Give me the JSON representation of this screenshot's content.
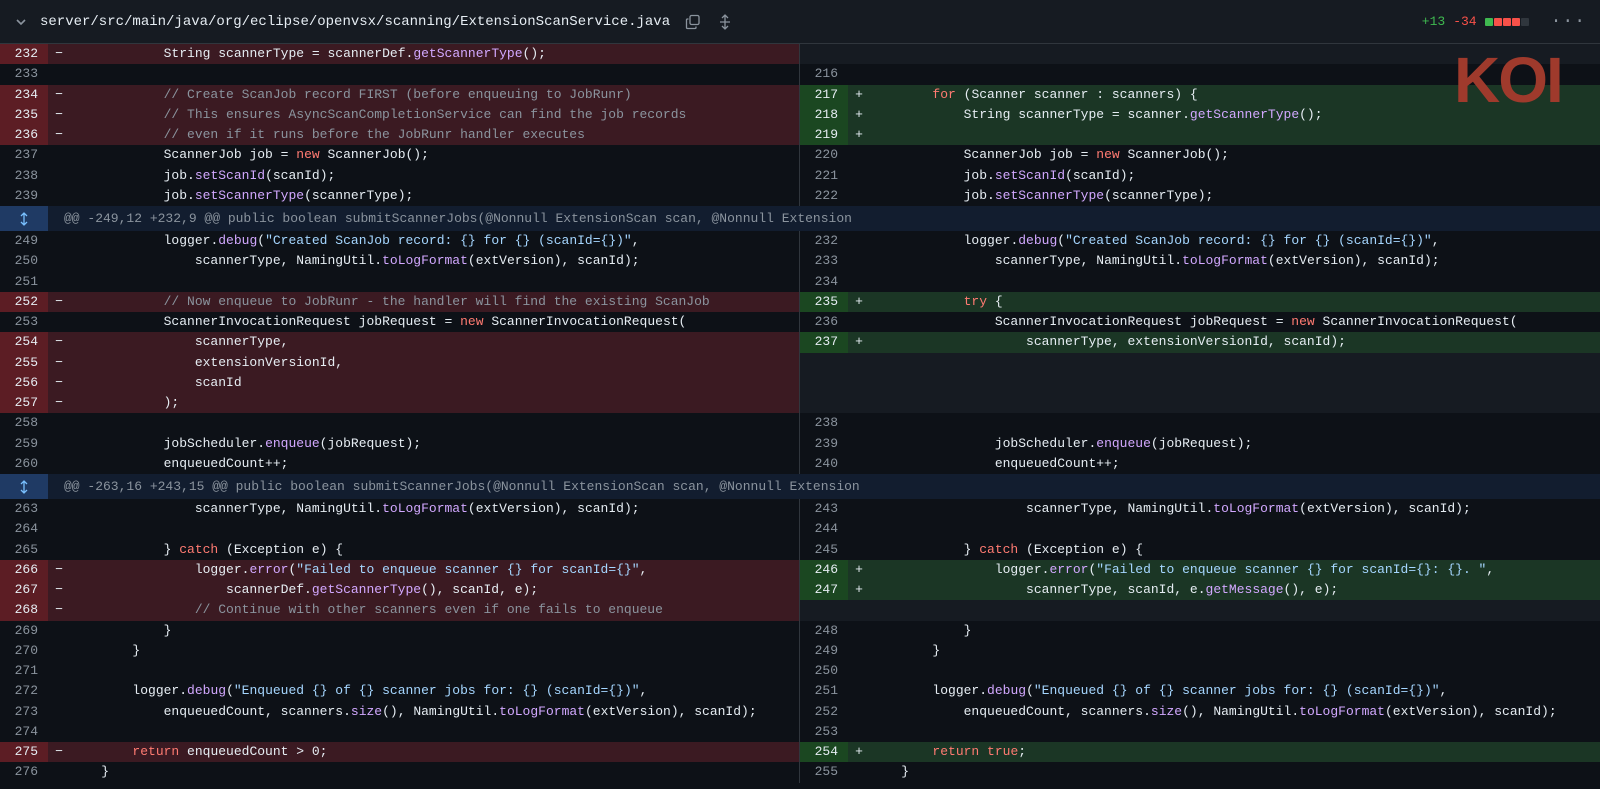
{
  "file": {
    "path": "server/src/main/java/org/eclipse/openvsx/scanning/ExtensionScanService.java",
    "additions": "+13",
    "deletions": "-34",
    "colors": {
      "add": "#3fb950",
      "del": "#f85149"
    }
  },
  "logo": {
    "text": "KOI",
    "color": "#9f3a2c"
  },
  "hunks": [
    "@@ -249,12 +232,9 @@ public boolean submitScannerJobs(@Nonnull ExtensionScan scan, @Nonnull Extension",
    "@@ -263,16 +243,15 @@ public boolean submitScannerJobs(@Nonnull ExtensionScan scan, @Nonnull Extension"
  ],
  "rows": [
    {
      "kind": "line",
      "l": {
        "n": "232",
        "t": "del",
        "c": "            String scannerType = scannerDef.getScannerType();"
      },
      "r": {
        "t": "empty"
      }
    },
    {
      "kind": "line",
      "l": {
        "n": "233",
        "t": "ctx",
        "c": ""
      },
      "r": {
        "n": "216",
        "t": "ctx",
        "c": ""
      }
    },
    {
      "kind": "line",
      "l": {
        "n": "234",
        "t": "del",
        "c": "            // Create ScanJob record FIRST (before enqueuing to JobRunr)"
      },
      "r": {
        "n": "217",
        "t": "add",
        "c": "        for (Scanner scanner : scanners) {"
      }
    },
    {
      "kind": "line",
      "l": {
        "n": "235",
        "t": "del",
        "c": "            // This ensures AsyncScanCompletionService can find the job records"
      },
      "r": {
        "n": "218",
        "t": "add",
        "c": "            String scannerType = scanner.getScannerType();"
      }
    },
    {
      "kind": "line",
      "l": {
        "n": "236",
        "t": "del",
        "c": "            // even if it runs before the JobRunr handler executes"
      },
      "r": {
        "n": "219",
        "t": "add",
        "c": ""
      }
    },
    {
      "kind": "line",
      "l": {
        "n": "237",
        "t": "ctx",
        "c": "            ScannerJob job = new ScannerJob();"
      },
      "r": {
        "n": "220",
        "t": "ctx",
        "c": "            ScannerJob job = new ScannerJob();"
      }
    },
    {
      "kind": "line",
      "l": {
        "n": "238",
        "t": "ctx",
        "c": "            job.setScanId(scanId);"
      },
      "r": {
        "n": "221",
        "t": "ctx",
        "c": "            job.setScanId(scanId);"
      }
    },
    {
      "kind": "line",
      "l": {
        "n": "239",
        "t": "ctx",
        "c": "            job.setScannerType(scannerType);"
      },
      "r": {
        "n": "222",
        "t": "ctx",
        "c": "            job.setScannerType(scannerType);"
      }
    },
    {
      "kind": "hunk",
      "h": 0
    },
    {
      "kind": "line",
      "l": {
        "n": "249",
        "t": "ctx",
        "c": "            logger.debug(\"Created ScanJob record: {} for {} (scanId={})\","
      },
      "r": {
        "n": "232",
        "t": "ctx",
        "c": "            logger.debug(\"Created ScanJob record: {} for {} (scanId={})\","
      }
    },
    {
      "kind": "line",
      "l": {
        "n": "250",
        "t": "ctx",
        "c": "                scannerType, NamingUtil.toLogFormat(extVersion), scanId);"
      },
      "r": {
        "n": "233",
        "t": "ctx",
        "c": "                scannerType, NamingUtil.toLogFormat(extVersion), scanId);"
      }
    },
    {
      "kind": "line",
      "l": {
        "n": "251",
        "t": "ctx",
        "c": ""
      },
      "r": {
        "n": "234",
        "t": "ctx",
        "c": ""
      }
    },
    {
      "kind": "line",
      "l": {
        "n": "252",
        "t": "del",
        "c": "            // Now enqueue to JobRunr - the handler will find the existing ScanJob"
      },
      "r": {
        "n": "235",
        "t": "add",
        "c": "            try {"
      }
    },
    {
      "kind": "line",
      "l": {
        "n": "253",
        "t": "ctx",
        "c": "            ScannerInvocationRequest jobRequest = new ScannerInvocationRequest("
      },
      "r": {
        "n": "236",
        "t": "ctx",
        "c": "                ScannerInvocationRequest jobRequest = new ScannerInvocationRequest("
      }
    },
    {
      "kind": "line",
      "l": {
        "n": "254",
        "t": "del",
        "c": "                scannerType,"
      },
      "r": {
        "n": "237",
        "t": "add",
        "c": "                    scannerType, extensionVersionId, scanId);"
      }
    },
    {
      "kind": "line",
      "l": {
        "n": "255",
        "t": "del",
        "c": "                extensionVersionId,"
      },
      "r": {
        "t": "empty"
      }
    },
    {
      "kind": "line",
      "l": {
        "n": "256",
        "t": "del",
        "c": "                scanId"
      },
      "r": {
        "t": "empty"
      }
    },
    {
      "kind": "line",
      "l": {
        "n": "257",
        "t": "del",
        "c": "            );"
      },
      "r": {
        "t": "empty"
      }
    },
    {
      "kind": "line",
      "l": {
        "n": "258",
        "t": "ctx",
        "c": ""
      },
      "r": {
        "n": "238",
        "t": "ctx",
        "c": ""
      }
    },
    {
      "kind": "line",
      "l": {
        "n": "259",
        "t": "ctx",
        "c": "            jobScheduler.enqueue(jobRequest);"
      },
      "r": {
        "n": "239",
        "t": "ctx",
        "c": "                jobScheduler.enqueue(jobRequest);"
      }
    },
    {
      "kind": "line",
      "l": {
        "n": "260",
        "t": "ctx",
        "c": "            enqueuedCount++;"
      },
      "r": {
        "n": "240",
        "t": "ctx",
        "c": "                enqueuedCount++;"
      }
    },
    {
      "kind": "hunk",
      "h": 1
    },
    {
      "kind": "line",
      "l": {
        "n": "263",
        "t": "ctx",
        "c": "                scannerType, NamingUtil.toLogFormat(extVersion), scanId);"
      },
      "r": {
        "n": "243",
        "t": "ctx",
        "c": "                    scannerType, NamingUtil.toLogFormat(extVersion), scanId);"
      }
    },
    {
      "kind": "line",
      "l": {
        "n": "264",
        "t": "ctx",
        "c": ""
      },
      "r": {
        "n": "244",
        "t": "ctx",
        "c": ""
      }
    },
    {
      "kind": "line",
      "l": {
        "n": "265",
        "t": "ctx",
        "c": "            } catch (Exception e) {"
      },
      "r": {
        "n": "245",
        "t": "ctx",
        "c": "            } catch (Exception e) {"
      }
    },
    {
      "kind": "line",
      "l": {
        "n": "266",
        "t": "del",
        "c": "                logger.error(\"Failed to enqueue scanner {} for scanId={}\","
      },
      "r": {
        "n": "246",
        "t": "add",
        "c": "                logger.error(\"Failed to enqueue scanner {} for scanId={}: {}. \","
      }
    },
    {
      "kind": "line",
      "l": {
        "n": "267",
        "t": "del",
        "c": "                    scannerDef.getScannerType(), scanId, e);"
      },
      "r": {
        "n": "247",
        "t": "add",
        "c": "                    scannerType, scanId, e.getMessage(), e);"
      }
    },
    {
      "kind": "line",
      "l": {
        "n": "268",
        "t": "del",
        "c": "                // Continue with other scanners even if one fails to enqueue"
      },
      "r": {
        "t": "empty"
      }
    },
    {
      "kind": "line",
      "l": {
        "n": "269",
        "t": "ctx",
        "c": "            }"
      },
      "r": {
        "n": "248",
        "t": "ctx",
        "c": "            }"
      }
    },
    {
      "kind": "line",
      "l": {
        "n": "270",
        "t": "ctx",
        "c": "        }"
      },
      "r": {
        "n": "249",
        "t": "ctx",
        "c": "        }"
      }
    },
    {
      "kind": "line",
      "l": {
        "n": "271",
        "t": "ctx",
        "c": ""
      },
      "r": {
        "n": "250",
        "t": "ctx",
        "c": ""
      }
    },
    {
      "kind": "line",
      "l": {
        "n": "272",
        "t": "ctx",
        "c": "        logger.debug(\"Enqueued {} of {} scanner jobs for: {} (scanId={})\","
      },
      "r": {
        "n": "251",
        "t": "ctx",
        "c": "        logger.debug(\"Enqueued {} of {} scanner jobs for: {} (scanId={})\","
      }
    },
    {
      "kind": "line",
      "l": {
        "n": "273",
        "t": "ctx",
        "c": "            enqueuedCount, scanners.size(), NamingUtil.toLogFormat(extVersion), scanId);"
      },
      "r": {
        "n": "252",
        "t": "ctx",
        "c": "            enqueuedCount, scanners.size(), NamingUtil.toLogFormat(extVersion), scanId);"
      }
    },
    {
      "kind": "line",
      "l": {
        "n": "274",
        "t": "ctx",
        "c": ""
      },
      "r": {
        "n": "253",
        "t": "ctx",
        "c": ""
      }
    },
    {
      "kind": "line",
      "l": {
        "n": "275",
        "t": "del",
        "c": "        return enqueuedCount > 0;"
      },
      "r": {
        "n": "254",
        "t": "add",
        "c": "        return true;"
      }
    },
    {
      "kind": "line",
      "l": {
        "n": "276",
        "t": "ctx",
        "c": "    }"
      },
      "r": {
        "n": "255",
        "t": "ctx",
        "c": "    }"
      }
    }
  ]
}
